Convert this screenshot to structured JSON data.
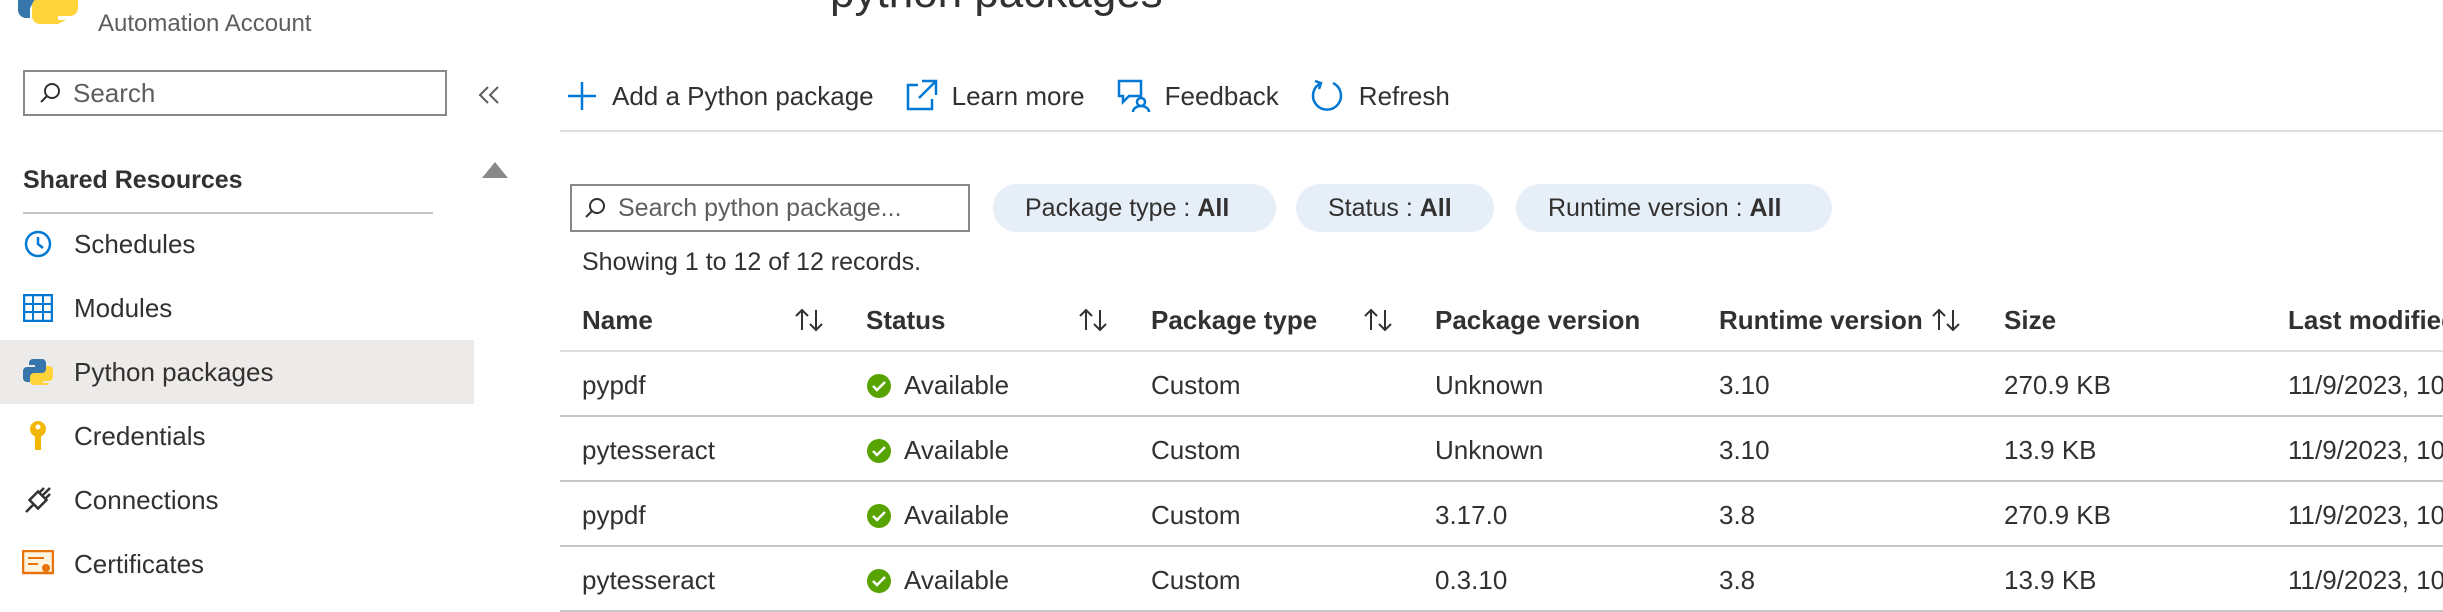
{
  "header": {
    "account_type": "Automation Account",
    "title_fragment": "python packages"
  },
  "sidebar": {
    "search_placeholder": "Search",
    "section_heading": "Shared Resources",
    "items": [
      {
        "label": "Schedules",
        "icon": "clock-icon",
        "active": false
      },
      {
        "label": "Modules",
        "icon": "modules-grid-icon",
        "active": false
      },
      {
        "label": "Python packages",
        "icon": "python-icon",
        "active": true
      },
      {
        "label": "Credentials",
        "icon": "key-icon",
        "active": false
      },
      {
        "label": "Connections",
        "icon": "plug-icon",
        "active": false
      },
      {
        "label": "Certificates",
        "icon": "certificate-icon",
        "active": false
      }
    ]
  },
  "toolbar": {
    "add_label": "Add a Python package",
    "learn_label": "Learn more",
    "feedback_label": "Feedback",
    "refresh_label": "Refresh"
  },
  "filters": {
    "search_placeholder": "Search python package...",
    "package_type_label": "Package type : ",
    "package_type_value": "All",
    "status_label": "Status : ",
    "status_value": "All",
    "runtime_label": "Runtime version : ",
    "runtime_value": "All"
  },
  "records_text": "Showing 1 to 12 of 12 records.",
  "table": {
    "columns": [
      "Name",
      "Status",
      "Package type",
      "Package version",
      "Runtime version",
      "Size",
      "Last modified"
    ],
    "rows": [
      {
        "name": "pypdf",
        "status": "Available",
        "type": "Custom",
        "version": "Unknown",
        "runtime": "3.10",
        "size": "270.9 KB",
        "modified": "11/9/2023, 10"
      },
      {
        "name": "pytesseract",
        "status": "Available",
        "type": "Custom",
        "version": "Unknown",
        "runtime": "3.10",
        "size": "13.9 KB",
        "modified": "11/9/2023, 10"
      },
      {
        "name": "pypdf",
        "status": "Available",
        "type": "Custom",
        "version": "3.17.0",
        "runtime": "3.8",
        "size": "270.9 KB",
        "modified": "11/9/2023, 10"
      },
      {
        "name": "pytesseract",
        "status": "Available",
        "type": "Custom",
        "version": "0.3.10",
        "runtime": "3.8",
        "size": "13.9 KB",
        "modified": "11/9/2023, 10"
      }
    ]
  },
  "colors": {
    "accent": "#0078d4",
    "success": "#57a300",
    "pill_bg": "#e6eef8",
    "active_nav": "#edebe9"
  }
}
